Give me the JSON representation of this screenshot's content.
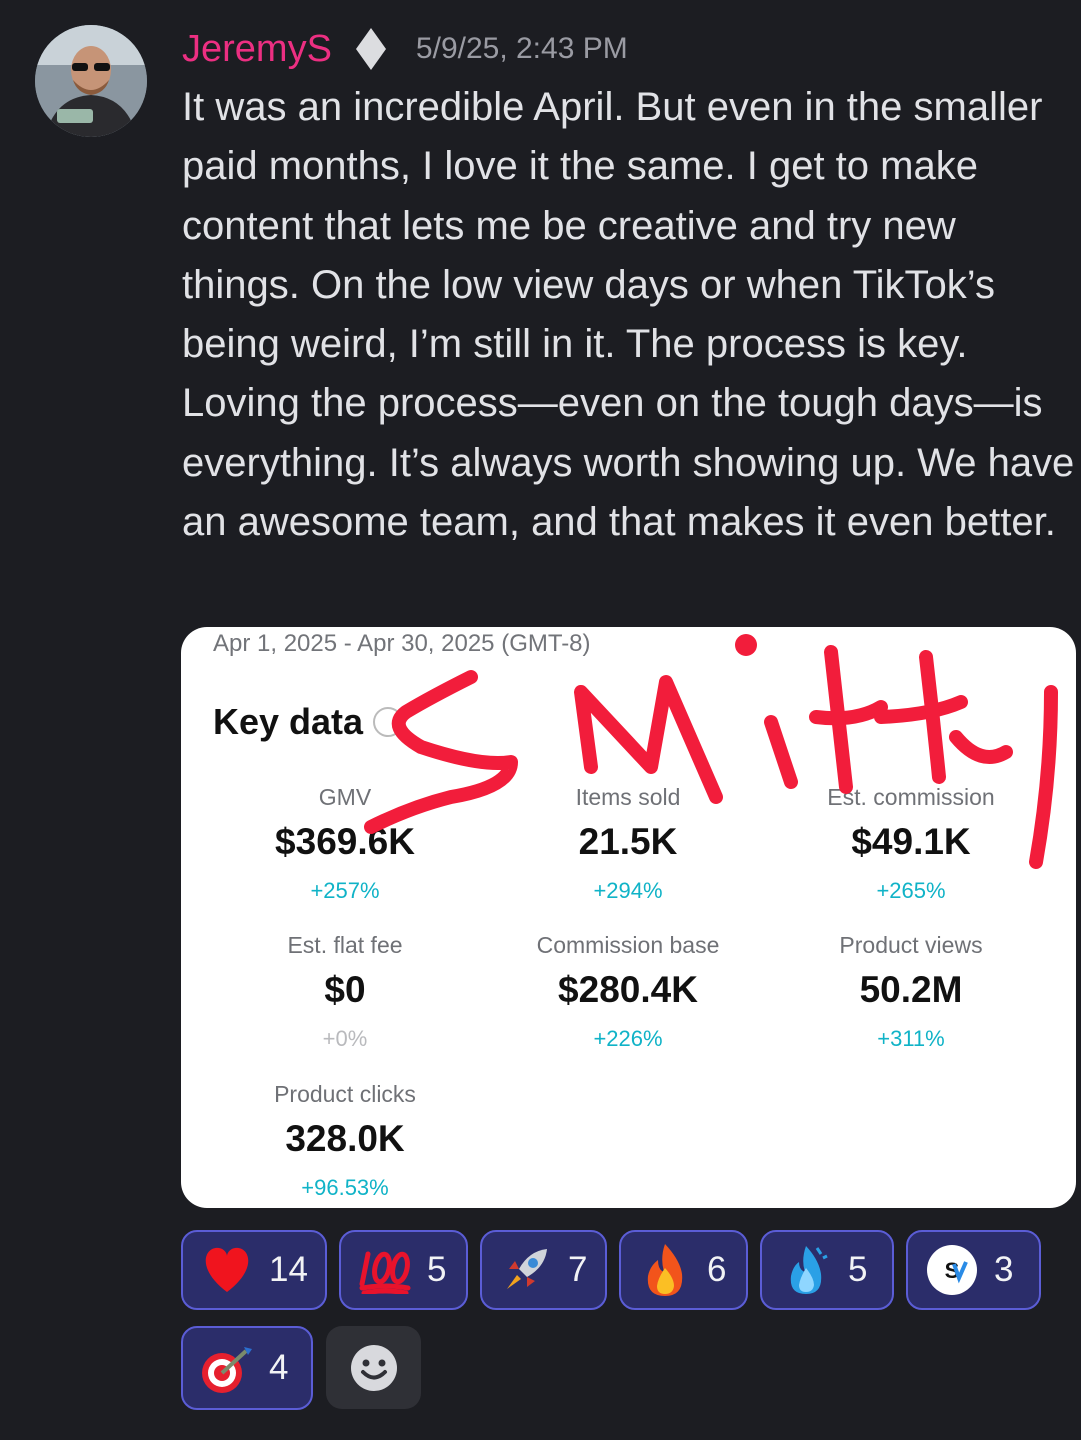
{
  "message": {
    "username": "JeremyS",
    "timestamp": "5/9/25, 2:43 PM",
    "text": "It was an incredible April. But even in the smaller paid months, I love it the same. I get to make content that lets me be creative and try new things. On the low view days or when TikTok’s being weird, I’m still in it. The process is key. Loving the process—even on the tough days—is everything. It’s always worth showing up. We have an awesome team, and that makes it even better.",
    "username_color": "#ec2f82"
  },
  "card": {
    "date_range": "Apr 1, 2025 - Apr 30, 2025 (GMT-8)",
    "title": "Key data",
    "handwritten_overlay": "Smitty",
    "metrics": [
      {
        "label": "GMV",
        "value": "$369.6K",
        "change": "+257%"
      },
      {
        "label": "Items sold",
        "value": "21.5K",
        "change": "+294%"
      },
      {
        "label": "Est. commission",
        "value": "$49.1K",
        "change": "+265%"
      },
      {
        "label": "Est. flat fee",
        "value": "$0",
        "change": "+0%"
      },
      {
        "label": "Commission base",
        "value": "$280.4K",
        "change": "+226%"
      },
      {
        "label": "Product views",
        "value": "50.2M",
        "change": "+311%"
      },
      {
        "label": "Product clicks",
        "value": "328.0K",
        "change": "+96.53%"
      }
    ],
    "change_color": "#10b3c7"
  },
  "reactions": [
    {
      "emoji": "heart-emoji",
      "count": "14"
    },
    {
      "emoji": "hundred-points-emoji",
      "count": "5"
    },
    {
      "emoji": "rocket-emoji",
      "count": "7"
    },
    {
      "emoji": "fire-emoji",
      "count": "6"
    },
    {
      "emoji": "blue-fire-emoji",
      "count": "5"
    },
    {
      "emoji": "sv-logo-emoji",
      "count": "3"
    },
    {
      "emoji": "direct-hit-emoji",
      "count": "4"
    }
  ],
  "reaction_accent": "#5b5dd6"
}
